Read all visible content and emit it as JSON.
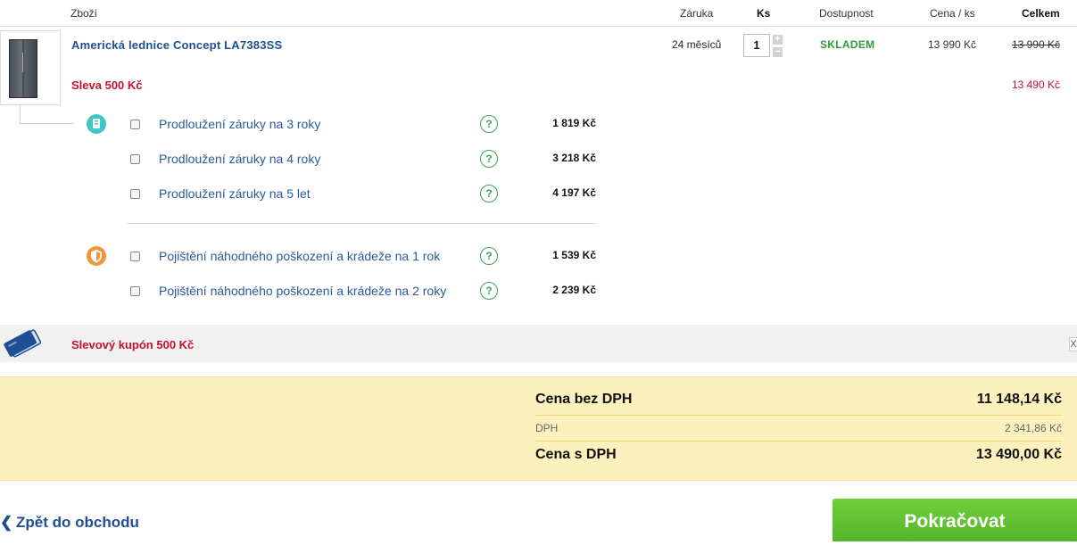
{
  "header": {
    "col_product": "Zboží",
    "col_warranty": "Záruka",
    "col_qty": "Ks",
    "col_availability": "Dostupnost",
    "col_unit_price": "Cena / ks",
    "col_total": "Celkem"
  },
  "product": {
    "name": "Americká lednice Concept LA7383SS",
    "warranty": "24 měsíců",
    "qty": "1",
    "qty_plus": "+",
    "qty_minus": "−",
    "availability": "SKLADEM",
    "unit_price": "13 990 Kč",
    "total_original": "13 990 Kč",
    "discount_label": "Sleva 500 Kč",
    "total_discounted": "13 490 Kč"
  },
  "services": {
    "warranty_extensions": [
      {
        "label": "Prodloužení záruky na 3 roky",
        "price": "1 819 Kč"
      },
      {
        "label": "Prodloužení záruky na 4 roky",
        "price": "3 218 Kč"
      },
      {
        "label": "Prodloužení záruky na 5 let",
        "price": "4 197 Kč"
      }
    ],
    "insurance": [
      {
        "label": "Pojištění náhodného poškození a krádeže na 1 rok",
        "price": "1 539 Kč"
      },
      {
        "label": "Pojištění náhodného poškození a krádeže na 2 roky",
        "price": "2 239 Kč"
      }
    ],
    "help_glyph": "?"
  },
  "coupon": {
    "label": "Slevový kupón 500 Kč",
    "close_glyph": "X"
  },
  "summary": {
    "without_vat_label": "Cena bez DPH",
    "without_vat_value": "11 148,14 Kč",
    "vat_label": "DPH",
    "vat_value": "2 341,86 Kč",
    "with_vat_label": "Cena s DPH",
    "with_vat_value": "13 490,00 Kč"
  },
  "footer": {
    "back_label": "Zpět do obchodu",
    "back_glyph": "❮",
    "continue_label": "Pokračovat"
  },
  "colors": {
    "brand_blue": "#1e4f93",
    "discount_red": "#c8102e",
    "stock_green": "#2e9b3e",
    "button_green": "#5ec132",
    "summary_bg": "#fcf1bd"
  }
}
